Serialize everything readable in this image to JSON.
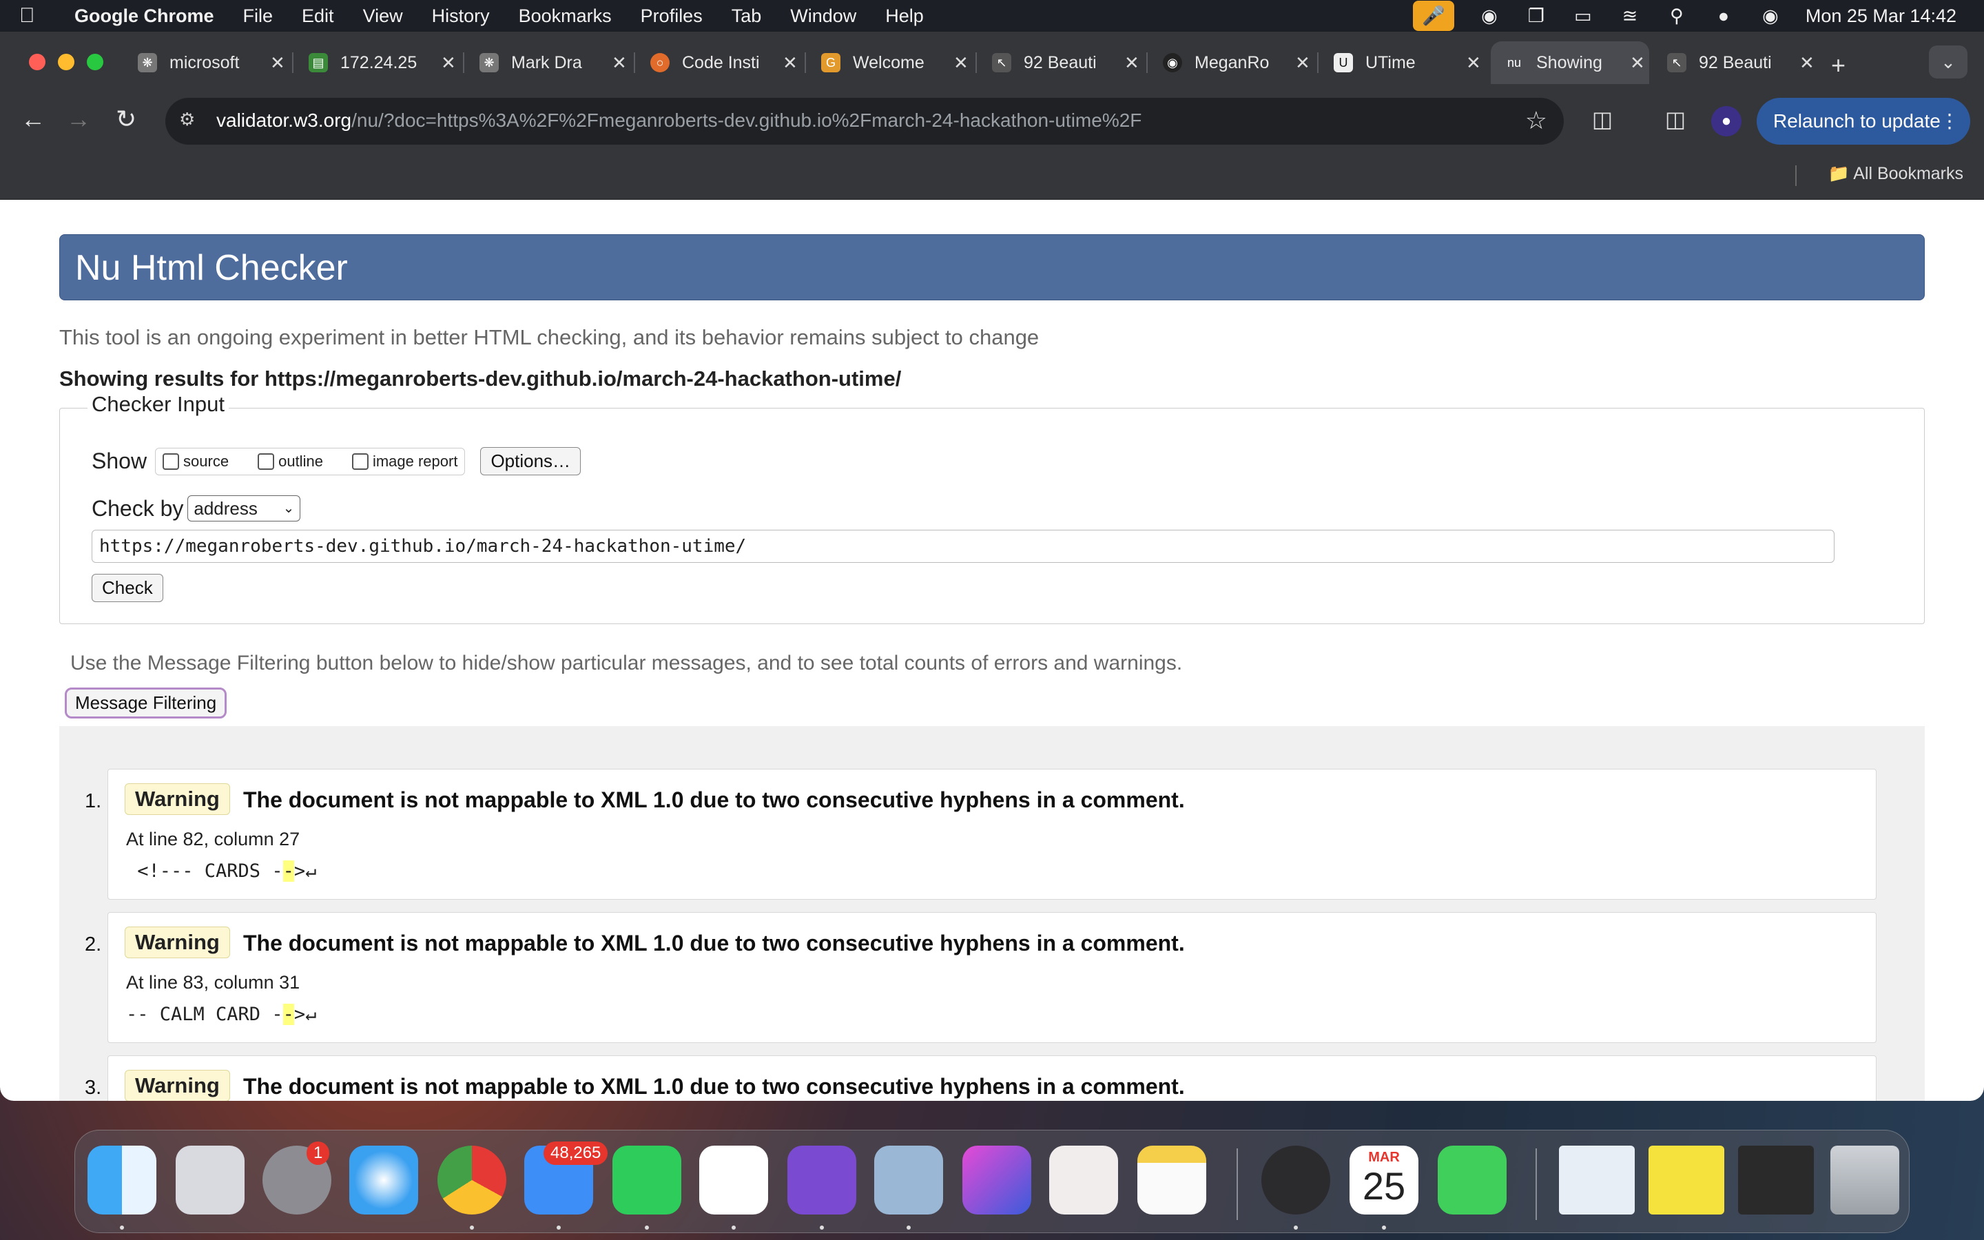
{
  "menubar": {
    "app": "Google Chrome",
    "items": [
      "File",
      "Edit",
      "View",
      "History",
      "Bookmarks",
      "Profiles",
      "Tab",
      "Window",
      "Help"
    ],
    "clock": "Mon 25 Mar  14:42"
  },
  "tabs": [
    {
      "title": "microsoft",
      "icon": "openai-icon"
    },
    {
      "title": "172.24.25",
      "icon": "monitor-icon"
    },
    {
      "title": "Mark Dra",
      "icon": "openai-icon"
    },
    {
      "title": "Code Insti",
      "icon": "circle-icon"
    },
    {
      "title": "Welcome",
      "icon": "g-icon"
    },
    {
      "title": "92 Beauti",
      "icon": "cursor-icon"
    },
    {
      "title": "MeganRo",
      "icon": "github-icon"
    },
    {
      "title": "UTime",
      "icon": "u-icon"
    },
    {
      "title": "Showing",
      "icon": "nu-icon"
    },
    {
      "title": "92 Beauti",
      "icon": "cursor-icon"
    }
  ],
  "toolbar": {
    "url_host": "validator.w3.org",
    "url_rest": "/nu/?doc=https%3A%2F%2Fmeganroberts-dev.github.io%2Fmarch-24-hackathon-utime%2F",
    "relaunch": "Relaunch to update",
    "all_bookmarks": "All Bookmarks"
  },
  "page": {
    "title": "Nu Html Checker",
    "intro": "This tool is an ongoing experiment in better HTML checking, and its behavior remains subject to change",
    "showing": "Showing results for https://meganroberts-dev.github.io/march-24-hackathon-utime/",
    "input": {
      "legend": "Checker Input",
      "show_label": "Show",
      "opt_source": "source",
      "opt_outline": "outline",
      "opt_image": "image report",
      "options_button": "Options…",
      "check_by_label": "Check by",
      "check_by_value": "address",
      "url_value": "https://meganroberts-dev.github.io/march-24-hackathon-utime/",
      "check_button": "Check"
    },
    "filter_text": "Use the Message Filtering button below to hide/show particular messages, and to see total counts of errors and warnings.",
    "filter_button": "Message Filtering",
    "messages": [
      {
        "num": "1.",
        "type": "Warning",
        "text": "The document is not mappable to XML 1.0 due to two consecutive hyphens in a comment.",
        "loc": "At line 82, column 27",
        "code_pre": " <!--- CARDS -",
        "code_hl": "-",
        "code_post": ">↵"
      },
      {
        "num": "2.",
        "type": "Warning",
        "text": "The document is not mappable to XML 1.0 due to two consecutive hyphens in a comment.",
        "loc": "At line 83, column 31",
        "code_pre": "-- CALM CARD -",
        "code_hl": "-",
        "code_post": ">↵"
      },
      {
        "num": "3.",
        "type": "Warning",
        "text": "The document is not mappable to XML 1.0 due to two consecutive hyphens in a comment.",
        "loc": "",
        "code_pre": "",
        "code_hl": "",
        "code_post": ""
      }
    ]
  },
  "dock": {
    "settings_badge": "1",
    "mail_badge": "48,265",
    "calendar_month": "MAR",
    "calendar_day": "25"
  }
}
